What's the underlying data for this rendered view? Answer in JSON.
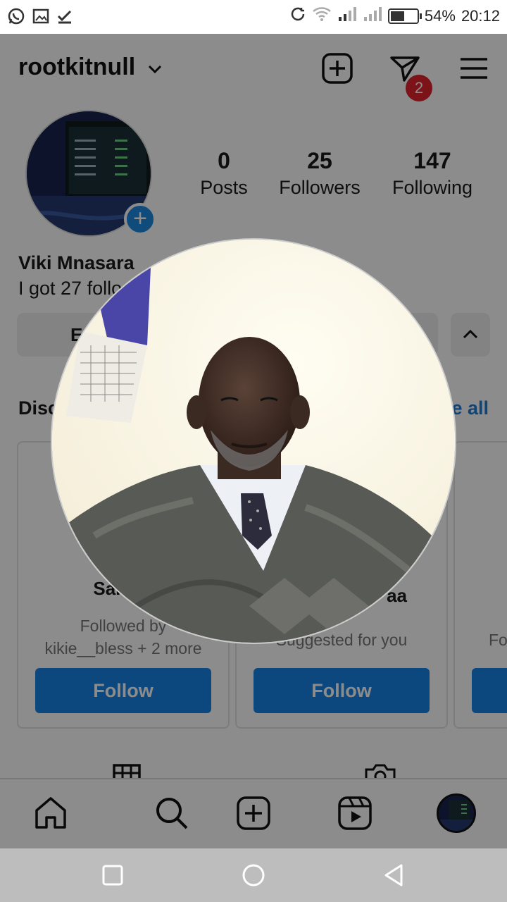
{
  "status_bar": {
    "battery": "54%",
    "battery_level": 0.54,
    "time": "20:12",
    "left_icons": [
      "whatsapp-icon",
      "picture-notification-icon",
      "checkmark-icon"
    ],
    "right_icons": [
      "sync-icon",
      "wifi-icon",
      "signal-icon",
      "signal-icon-2",
      "battery-icon"
    ]
  },
  "header": {
    "username": "rootkitnull",
    "dm_badge": "2"
  },
  "profile": {
    "stats": [
      {
        "num": "0",
        "label": "Posts"
      },
      {
        "num": "25",
        "label": "Followers"
      },
      {
        "num": "147",
        "label": "Following"
      }
    ],
    "name": "Viki Mnasara",
    "bio_visible": "I got 27 follo",
    "edit_button_visible": "E"
  },
  "discover": {
    "title_visible": "Disc",
    "see_all_visible": "e all",
    "cards": [
      {
        "name_visible": "Samue",
        "sub1_visible": "Followed by",
        "sub2": "kikie__bless + 2 more",
        "button": "Follow"
      },
      {
        "name_visible": "aa",
        "sub1_visible": "Suggested for you",
        "button": "Follow"
      },
      {
        "sub1_visible": "Fo"
      }
    ]
  },
  "colors": {
    "accent": "#1783e4",
    "badge": "#e0242c",
    "dim_overlay": "rgba(0,0,0,0.45)"
  }
}
